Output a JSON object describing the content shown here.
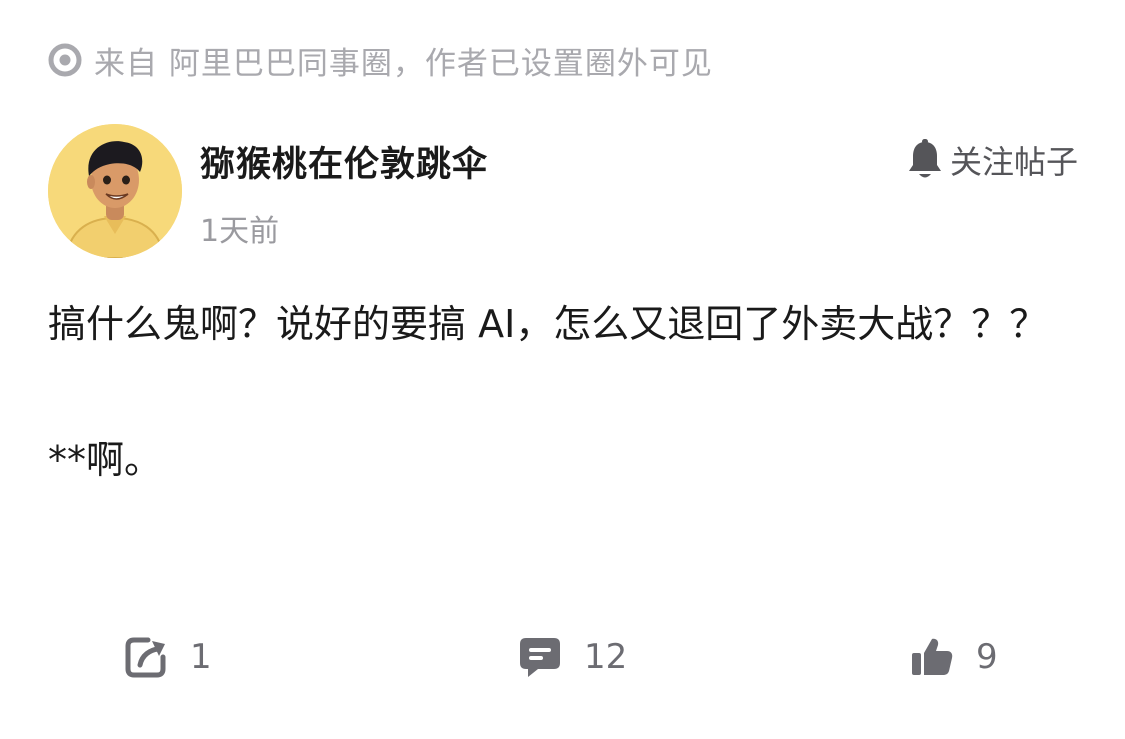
{
  "source": {
    "icon": "circle-dot-icon",
    "text": "来自 阿里巴巴同事圈，作者已设置圈外可见"
  },
  "author": {
    "name": "猕猴桃在伦敦跳伞",
    "time": "1天前",
    "avatar_icon": "cartoon-avatar"
  },
  "follow": {
    "icon": "bell-icon",
    "label": "关注帖子"
  },
  "post": {
    "paragraphs": [
      "搞什么鬼啊？说好的要搞 AI，怎么又退回了外卖大战？？？",
      "**啊。"
    ]
  },
  "actions": {
    "share": {
      "icon": "share-icon",
      "count": "1"
    },
    "comment": {
      "icon": "comment-icon",
      "count": "12"
    },
    "like": {
      "icon": "thumbs-up-icon",
      "count": "9"
    }
  },
  "colors": {
    "muted_text": "#a9a9ae",
    "icon_gray": "#6c6c72",
    "avatar_bg": "#f7d97a"
  }
}
